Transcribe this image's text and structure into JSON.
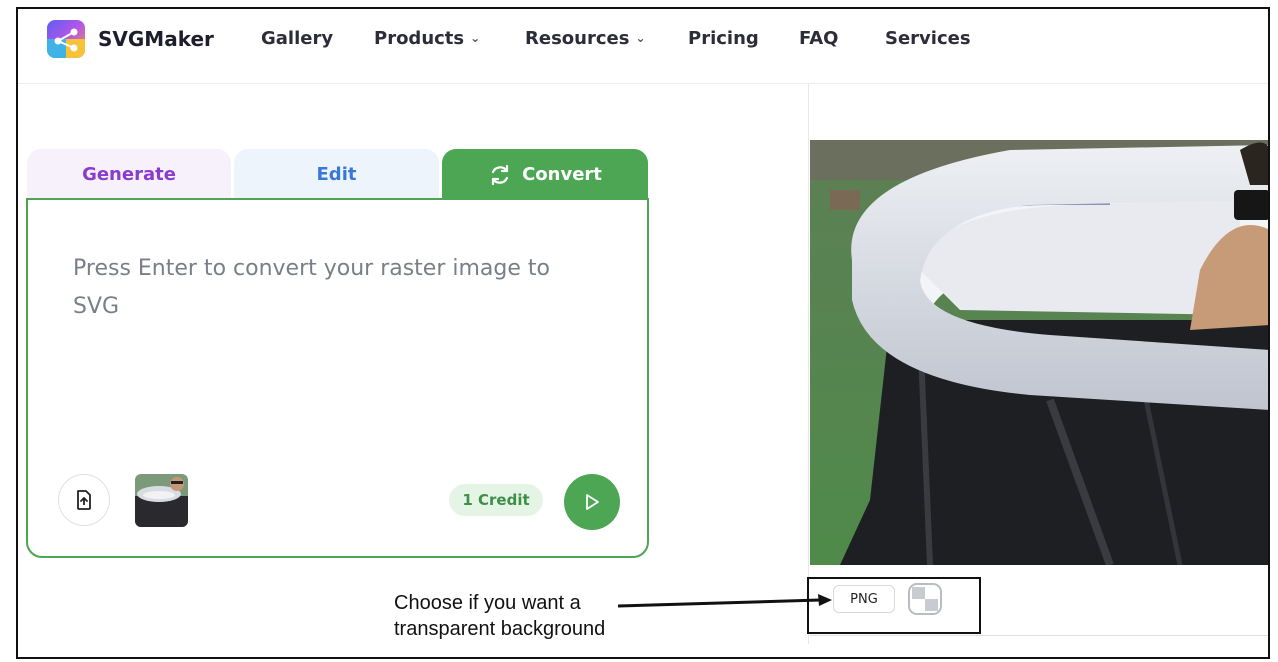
{
  "brand": {
    "name": "SVGMaker",
    "logo_icon": "share-nodes-icon"
  },
  "nav": {
    "items": [
      {
        "label": "Gallery",
        "dropdown": false
      },
      {
        "label": "Products",
        "dropdown": true
      },
      {
        "label": "Resources",
        "dropdown": true
      },
      {
        "label": "Pricing",
        "dropdown": false
      },
      {
        "label": "FAQ",
        "dropdown": false
      },
      {
        "label": "Services",
        "dropdown": false
      }
    ],
    "chevron": "⌄"
  },
  "tool": {
    "tabs": [
      {
        "label": "Generate",
        "active": false,
        "color": "#8a3bd0"
      },
      {
        "label": "Edit",
        "active": false,
        "color": "#3a78d8"
      },
      {
        "label": "Convert",
        "active": true,
        "color": "#4ca654",
        "icon": "refresh-icon"
      }
    ],
    "placeholder": "Press Enter to convert your raster image to SVG",
    "upload_icon": "file-upload-icon",
    "credit_label": "1 Credit",
    "send_icon": "play-icon"
  },
  "preview": {
    "format_button": "PNG",
    "transparent_icon": "checkerboard-icon"
  },
  "annotation": {
    "line1": "Choose if you want a",
    "line2": "transparent background"
  },
  "colors": {
    "accent": "#4ca654",
    "generate": "#8a3bd0",
    "edit": "#3a78d8"
  }
}
